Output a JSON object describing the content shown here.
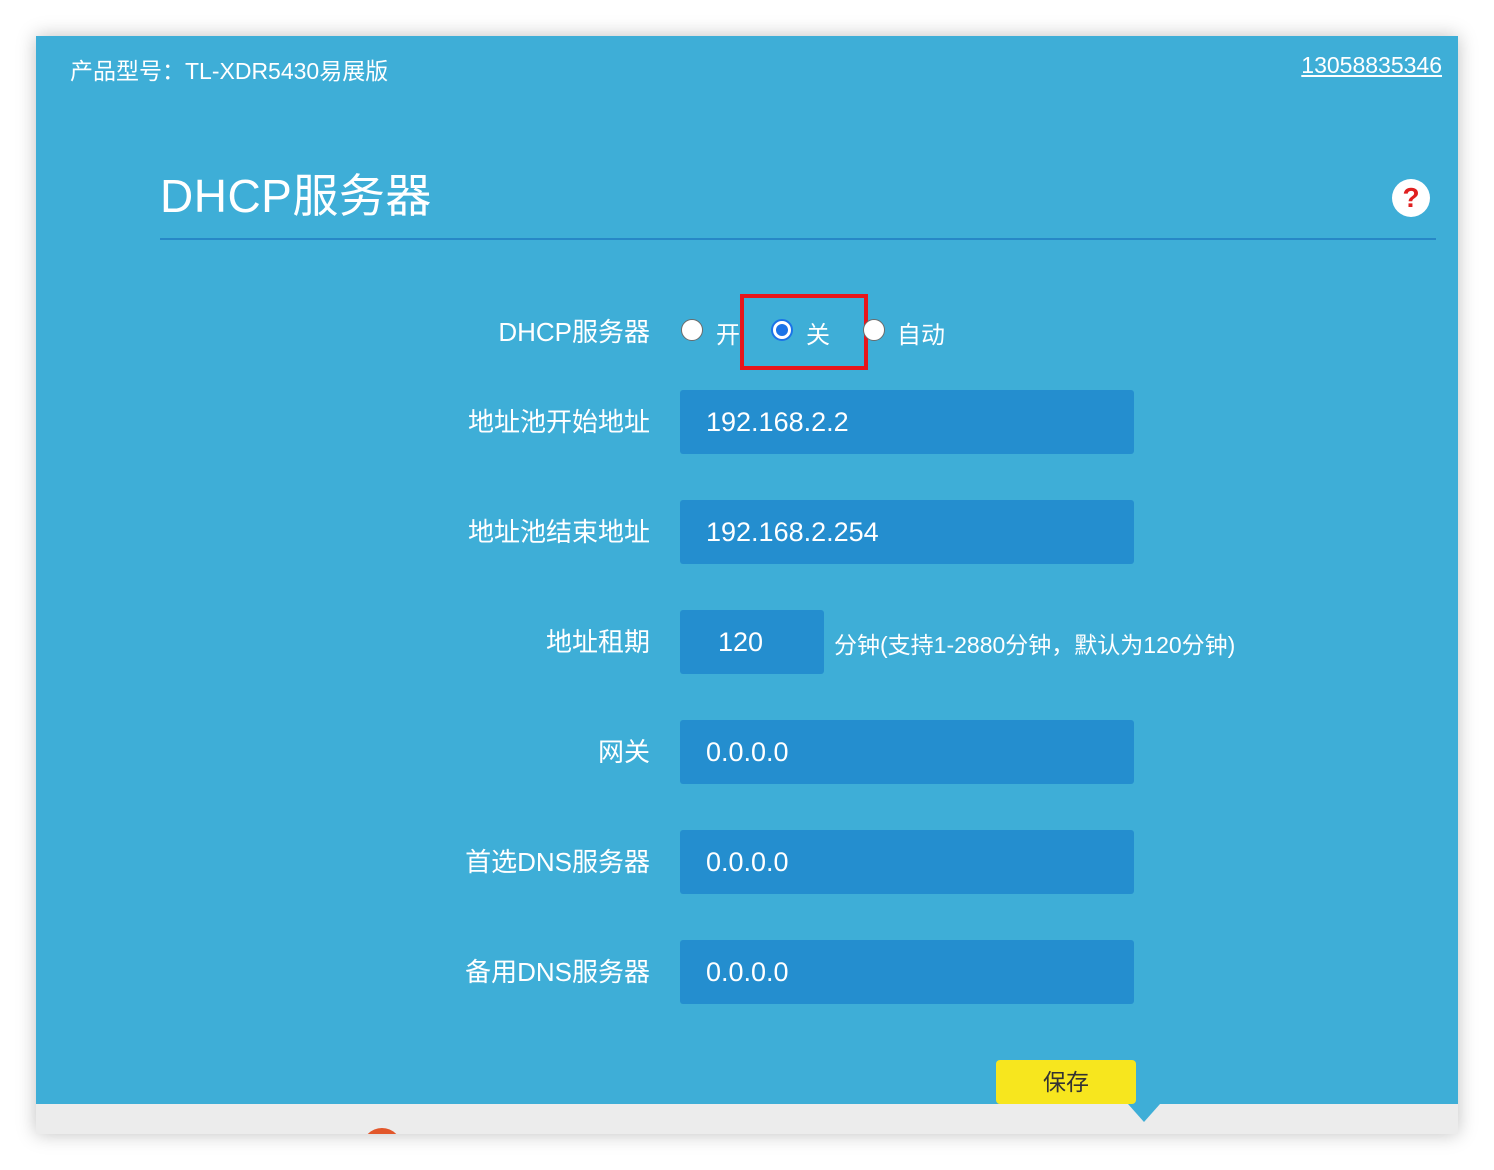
{
  "header": {
    "model_text": "产品型号：TL-XDR5430易展版",
    "account": "13058835346"
  },
  "page": {
    "title": "DHCP服务器",
    "help_icon": "question-mark-icon",
    "help_glyph": "?"
  },
  "form": {
    "dhcp": {
      "label": "DHCP服务器",
      "options": [
        "开",
        "关",
        "自动"
      ],
      "selected": "关"
    },
    "pool_start": {
      "label": "地址池开始地址",
      "value": "192.168.2.2"
    },
    "pool_end": {
      "label": "地址池结束地址",
      "value": "192.168.2.254"
    },
    "lease": {
      "label": "地址租期",
      "value": "120",
      "hint": "分钟(支持1-2880分钟，默认为120分钟)"
    },
    "gateway": {
      "label": "网关",
      "value": "0.0.0.0"
    },
    "dns_primary": {
      "label": "首选DNS服务器",
      "value": "0.0.0.0"
    },
    "dns_backup": {
      "label": "备用DNS服务器",
      "value": "0.0.0.0"
    }
  },
  "actions": {
    "save_label": "保存"
  },
  "colors": {
    "background": "#3eaed7",
    "field": "#248ecf",
    "save_button": "#f7e61e",
    "highlight": "#e8151b",
    "radio_selected": "#1a73e8"
  }
}
